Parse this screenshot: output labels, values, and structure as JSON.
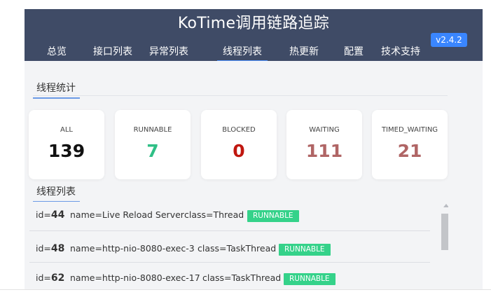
{
  "header": {
    "title": "KoTime调用链路追踪",
    "version": "v2.4.2",
    "nav": [
      {
        "label": "总览",
        "active": false
      },
      {
        "label": "接口列表",
        "active": false
      },
      {
        "label": "异常列表",
        "active": false
      },
      {
        "label": "线程列表",
        "active": true
      },
      {
        "label": "热更新",
        "active": false
      },
      {
        "label": "配置",
        "active": false
      },
      {
        "label": "技术支持",
        "active": false
      }
    ]
  },
  "stats": {
    "title": "线程统计",
    "cards": [
      {
        "label": "ALL",
        "value": "139",
        "color": "#111111"
      },
      {
        "label": "RUNNABLE",
        "value": "7",
        "color": "#2fbf86"
      },
      {
        "label": "BLOCKED",
        "value": "0",
        "color": "#c0170f"
      },
      {
        "label": "WAITING",
        "value": "111",
        "color": "#b06565"
      },
      {
        "label": "TIMED_WAITING",
        "value": "21",
        "color": "#b06565"
      }
    ]
  },
  "threads": {
    "title": "线程列表",
    "rows": [
      {
        "id_prefix": "id=",
        "id": "44",
        "name": "name=Live Reload Server",
        "class": "class=Thread",
        "state": "RUNNABLE"
      },
      {
        "id_prefix": "id=",
        "id": "48",
        "name": "name=http-nio-8080-exec-3",
        "class": "class=TaskThread",
        "state": "RUNNABLE"
      },
      {
        "id_prefix": "id=",
        "id": "62",
        "name": "name=http-nio-8080-exec-17",
        "class": "class=TaskThread",
        "state": "RUNNABLE"
      }
    ]
  },
  "colors": {
    "header_bg": "#3f4b66",
    "content_bg": "#f3f4f6",
    "accent": "#3a86ff",
    "runnable_badge": "#35d28a"
  }
}
